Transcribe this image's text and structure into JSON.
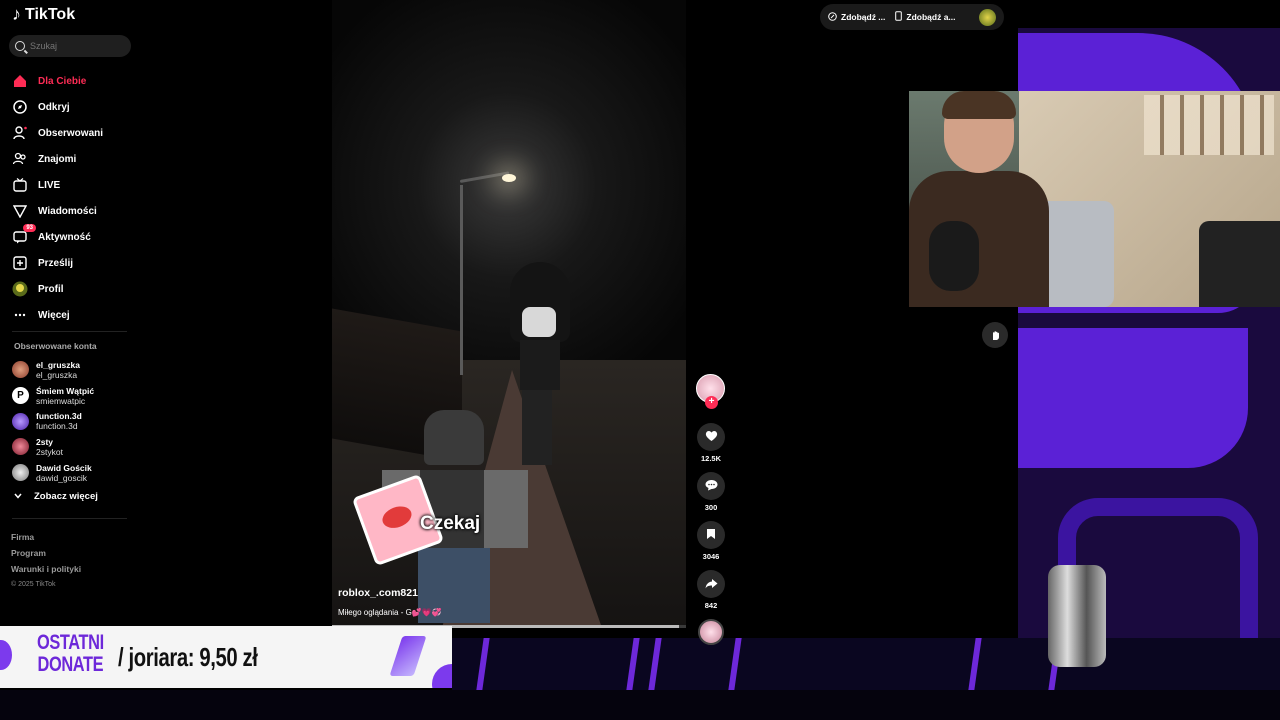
{
  "app": {
    "name": "TikTok"
  },
  "search": {
    "placeholder": "Szukaj"
  },
  "nav": {
    "items": [
      {
        "label": "Dla Ciebie",
        "icon": "home-icon",
        "active": true
      },
      {
        "label": "Odkryj",
        "icon": "compass-icon"
      },
      {
        "label": "Obserwowani",
        "icon": "user-follow-icon"
      },
      {
        "label": "Znajomi",
        "icon": "friends-icon"
      },
      {
        "label": "LIVE",
        "icon": "live-icon"
      },
      {
        "label": "Wiadomości",
        "icon": "send-icon"
      },
      {
        "label": "Aktywność",
        "icon": "activity-icon",
        "badge": "93"
      },
      {
        "label": "Prześlij",
        "icon": "upload-icon"
      },
      {
        "label": "Profil",
        "icon": "profile-avatar-icon"
      },
      {
        "label": "Więcej",
        "icon": "more-icon"
      }
    ]
  },
  "followed": {
    "title": "Obserwowane konta",
    "accounts": [
      {
        "name": "el_gruszka",
        "handle": "el_gruszka",
        "color": "#b65a4a"
      },
      {
        "name": "Śmiem Wątpić",
        "handle": "smiemwatpic",
        "color": "#ffffff"
      },
      {
        "name": "function.3d",
        "handle": "function.3d",
        "color": "#7b4fd6"
      },
      {
        "name": "2sty",
        "handle": "2stykot",
        "color": "#c23a52"
      },
      {
        "name": "Dawid Gościk",
        "handle": "dawid_goscik",
        "color": "#d9d9d9"
      }
    ],
    "see_more": "Zobacz więcej"
  },
  "footer": {
    "links": [
      "Firma",
      "Program",
      "Warunki i polityki"
    ],
    "copyright": "© 2025 TikTok"
  },
  "top_actions": {
    "get_coins": "Zdobądź ...",
    "get_app": "Zdobądź a..."
  },
  "video": {
    "overlay_text": "Czekaj",
    "author": "roblox_.com821",
    "description": "Miłego oglądania - G💕💗💞",
    "progress": 0.98
  },
  "actions": {
    "likes": "12.5K",
    "comments": "300",
    "saves": "3046",
    "shares": "842"
  },
  "donate": {
    "title_line1": "OSTATNI",
    "title_line2": "DONATE",
    "value": "/ joriara: 9,50 zł"
  },
  "colors": {
    "accent": "#fe2c55",
    "donate_purple": "#6d28d9",
    "overlay_purple": "#5b21d6"
  }
}
